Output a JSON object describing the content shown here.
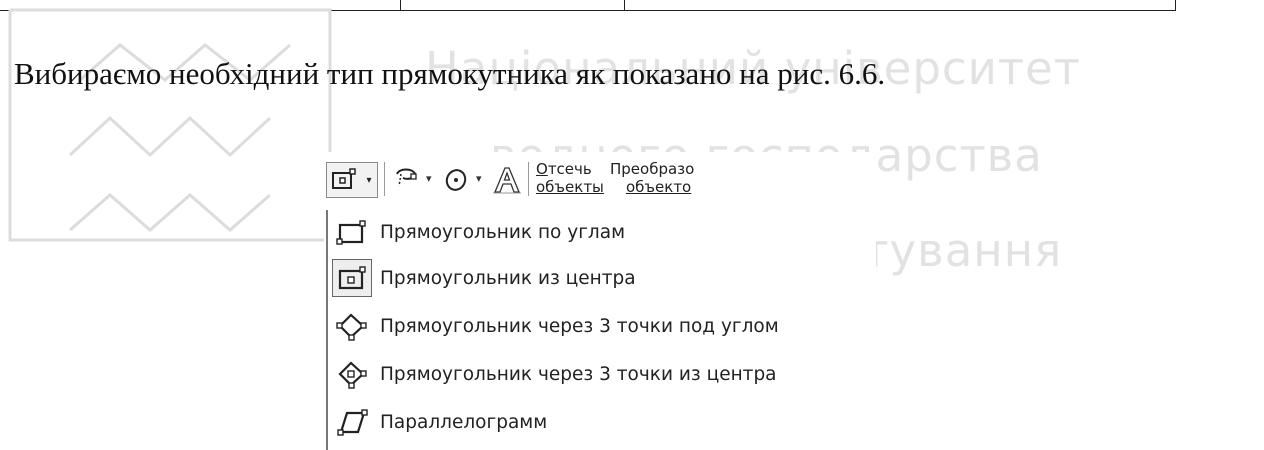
{
  "watermark": {
    "line1": "Національний університет",
    "line2": "водного господарства",
    "line3": "та природокористування"
  },
  "paragraph": {
    "text": "Вибираємо необхідний тип прямокутника як показано на рис. 6.6."
  },
  "toolbar": {
    "rectangle_icon": "rectangle-center-icon",
    "lasso_icon": "lasso-icon",
    "ellipse_icon": "ellipse-icon",
    "text_icon": "outline-text-icon",
    "trim_label_line1": "Отсечь",
    "trim_label_line2": "объекты",
    "transform_label_line1": "Преобразо",
    "transform_label_line2": "объекто"
  },
  "menu": {
    "items": [
      {
        "label": "Прямоугольник по углам",
        "icon": "rectangle-corners-icon",
        "selected": false
      },
      {
        "label": "Прямоугольник из центра",
        "icon": "rectangle-center-icon",
        "selected": true
      },
      {
        "label": "Прямоугольник через 3 точки под углом",
        "icon": "rectangle-3point-icon",
        "selected": false
      },
      {
        "label": "Прямоугольник через 3 точки из центра",
        "icon": "rectangle-3point-center-icon",
        "selected": false
      },
      {
        "label": "Параллелограмм",
        "icon": "parallelogram-icon",
        "selected": false
      }
    ]
  }
}
